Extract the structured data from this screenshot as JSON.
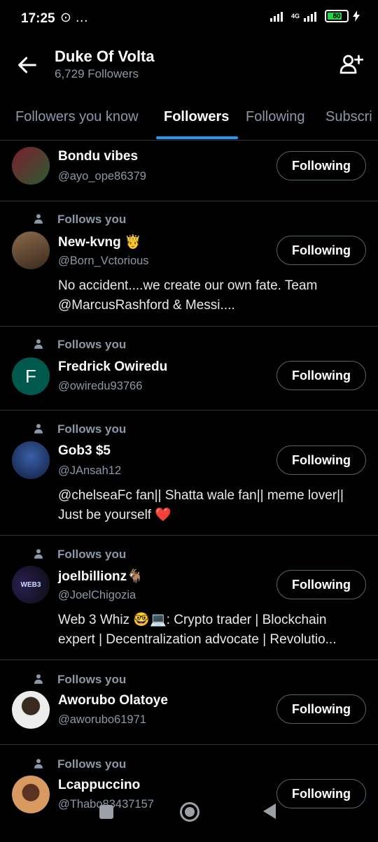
{
  "status": {
    "time": "17:25",
    "extra_icons": "⊙ …",
    "network": "4G",
    "battery": 80
  },
  "header": {
    "title": "Duke Of Volta",
    "subtitle": "6,729 Followers"
  },
  "tabs": [
    {
      "label": "Followers you know"
    },
    {
      "label": "Followers"
    },
    {
      "label": "Following"
    },
    {
      "label": "Subscri"
    }
  ],
  "active_tab": "Followers",
  "follows_you_label": "Follows you",
  "rows": [
    {
      "name": "Bondu vibes",
      "handle": "@ayo_ope86379",
      "button": "Following",
      "bio": "",
      "avatar_color": "#4a2a3a"
    },
    {
      "name": "New-kvng 🤴",
      "handle": "@Born_Vctorious",
      "button": "Following",
      "bio": "No accident....we create our own fate. Team @MarcusRashford & Messi....",
      "avatar_color": "#5a4a3a"
    },
    {
      "name": "Fredrick Owiredu",
      "handle": "@owiredu93766",
      "button": "Following",
      "bio": "",
      "avatar_letter": "F",
      "avatar_color": "#00594d"
    },
    {
      "name": "Gob3 $5",
      "handle": "@JAnsah12",
      "button": "Following",
      "bio": "@chelseaFc fan|| Shatta wale fan|| meme lover|| Just be yourself ❤️",
      "avatar_color": "#1e3a6e"
    },
    {
      "name": "joelbillionz🐐",
      "handle": "@JoelChigozia",
      "button": "Following",
      "bio": "Web 3 Whiz 🤓💻: Crypto trader | Blockchain expert | Decentralization advocate | Revolutio...",
      "avatar_text": "WEB3",
      "avatar_color": "#14121f"
    },
    {
      "name": "Aworubo Olatoye",
      "handle": "@aworubo61971",
      "button": "Following",
      "bio": "",
      "avatar_color": "#eeeeee"
    },
    {
      "name": "Lcappuccino",
      "handle": "@Thabo83437157",
      "button": "Following",
      "bio": "",
      "avatar_color": "#c98a55"
    }
  ],
  "colors": {
    "accent": "#1d9bf0",
    "background": "#000000",
    "secondary_text": "#8b98a5",
    "divider": "#2f3336"
  }
}
